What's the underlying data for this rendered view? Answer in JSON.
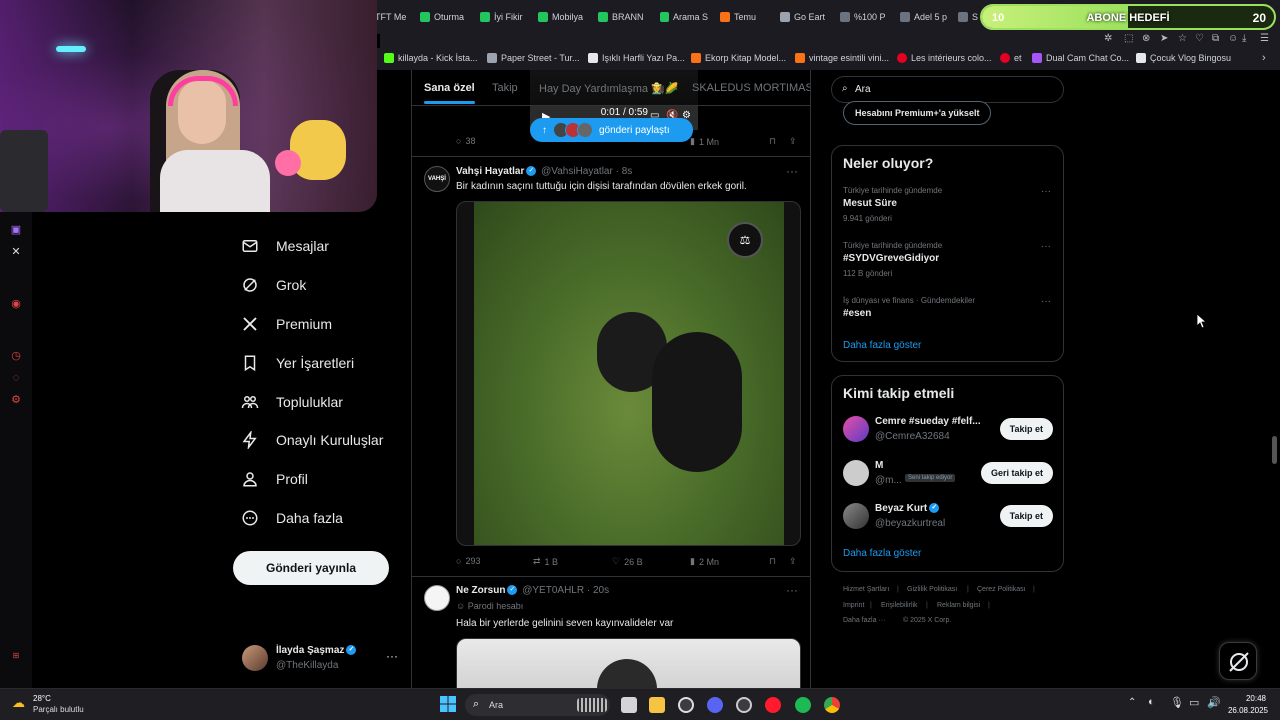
{
  "browser": {
    "tabs": [
      {
        "label": "TFT Me",
        "color": "#3b82f6"
      },
      {
        "label": "Oturma",
        "color": "#22c55e"
      },
      {
        "label": "İyi Fikir",
        "color": "#22c55e"
      },
      {
        "label": "Mobilya",
        "color": "#22c55e"
      },
      {
        "label": "BRANN",
        "color": "#22c55e"
      },
      {
        "label": "Arama S",
        "color": "#22c55e"
      },
      {
        "label": "Temu",
        "color": "#f97316"
      },
      {
        "label": "Go Eart",
        "color": "#9ca3af"
      },
      {
        "label": "%100 P",
        "color": "#6b7280"
      },
      {
        "label": "Adel 5 p",
        "color": "#6b7280"
      },
      {
        "label": "S",
        "color": "#6b7280"
      }
    ],
    "bookmarks": [
      {
        "label": "killayda - Kick İsta...",
        "color": "#53fc18"
      },
      {
        "label": "Paper Street - Tur...",
        "color": "#9ca3af"
      },
      {
        "label": "Işıklı Harfli Yazı Pa...",
        "color": "#e5e7eb"
      },
      {
        "label": "Ekorp Kitap Model...",
        "color": "#f97316"
      },
      {
        "label": "vintage esintili vini...",
        "color": "#f97316"
      },
      {
        "label": "Les intérieurs colo...",
        "color": "#e60023"
      },
      {
        "label": "et",
        "color": "#e60023"
      },
      {
        "label": "Dual Cam Chat Co...",
        "color": "#a855f7"
      },
      {
        "label": "Çocuk Vlog Bingosu",
        "color": "#e5e7eb"
      }
    ]
  },
  "goal": {
    "label": "ABONE HEDEFİ",
    "current": "10",
    "target": "20",
    "progress": 0.5
  },
  "nav": {
    "items": [
      {
        "label": "Mesajlar",
        "icon": "envelope-icon"
      },
      {
        "label": "Grok",
        "icon": "grok-icon"
      },
      {
        "label": "Premium",
        "icon": "x-logo-icon"
      },
      {
        "label": "Yer İşaretleri",
        "icon": "bookmark-icon"
      },
      {
        "label": "Topluluklar",
        "icon": "communities-icon"
      },
      {
        "label": "Onaylı Kuruluşlar",
        "icon": "lightning-icon"
      },
      {
        "label": "Profil",
        "icon": "person-icon"
      },
      {
        "label": "Daha fazla",
        "icon": "more-circle-icon"
      }
    ],
    "post_button": "Gönderi yayınla",
    "account": {
      "name": "İlayda Şaşmaz",
      "handle": "@TheKillayda"
    }
  },
  "timeline": {
    "tabs": [
      "Sana özel",
      "Takip",
      "Hay Day Yardımlaşma 👩‍🌾🌽",
      "SKALEDUS MORTIMAS"
    ],
    "video_time": "0:01 / 0:59",
    "share_pill": "gönderi paylaştı",
    "tweet0_actions": {
      "replies": "38",
      "views": "1 Mn"
    },
    "tweet1": {
      "name": "Vahşi Hayatlar",
      "handle": "@VahsiHayatlar · 8s",
      "text": "Bir kadının saçını tuttuğu için dişisi tarafından dövülen erkek goril.",
      "avatar_text": "VAHŞİ",
      "replies": "293",
      "reposts": "1 B",
      "likes": "26 B",
      "views": "2 Mn"
    },
    "tweet2": {
      "name": "Ne Zorsun",
      "handle": "@YET0AHLR · 20s",
      "label": "Parodi hesabı",
      "text": "Hala bir yerlerde gelinini seven kayınvalideler var"
    }
  },
  "sidebar": {
    "search_placeholder": "Ara",
    "premium_button": "Hesabını Premium+'a yükselt",
    "trends_title": "Neler oluyor?",
    "trends": [
      {
        "category": "Türkiye tarihinde gündemde",
        "name": "Mesut Süre",
        "count": "9.941 gönderi"
      },
      {
        "category": "Türkiye tarihinde gündemde",
        "name": "#SYDVGreveGidiyor",
        "count": "112 B gönderi"
      },
      {
        "category": "İş dünyası ve finans · Gündemdekiler",
        "name": "#esen",
        "count": ""
      }
    ],
    "show_more": "Daha fazla göster",
    "who_title": "Kimi takip etmeli",
    "who": [
      {
        "name": "Cemre #sueday #felf...",
        "handle": "@CemreA32684",
        "button": "Takip et",
        "note": ""
      },
      {
        "name": "M",
        "handle": "@m...",
        "button": "Geri takip et",
        "note": "Seni takip ediyor"
      },
      {
        "name": "Beyaz Kurt",
        "handle": "@beyazkurtreal",
        "button": "Takip et",
        "note": ""
      }
    ],
    "who_more": "Daha fazla göster",
    "footer": [
      "Hizmet Şartları",
      "Gizlilik Politikası",
      "Çerez Politikası",
      "Imprint",
      "Erişilebilirlik",
      "Reklam bilgisi",
      "Daha fazla ···",
      "© 2025 X Corp."
    ]
  },
  "taskbar": {
    "weather_temp": "28°C",
    "weather_desc": "Parçalı bulutlu",
    "search_label": "Ara",
    "time": "20:48",
    "date": "26.08.2025"
  }
}
